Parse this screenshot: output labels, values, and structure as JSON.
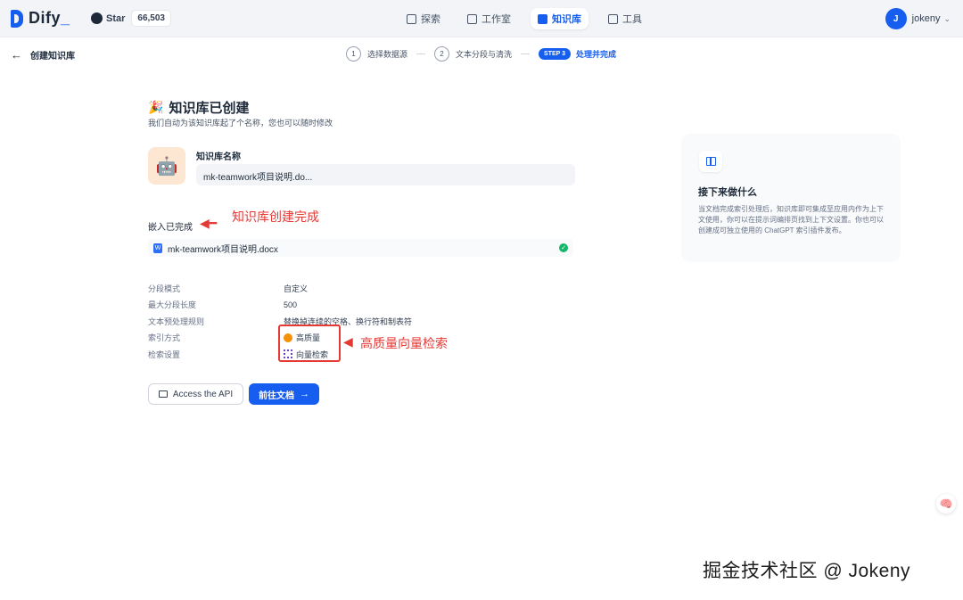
{
  "topbar": {
    "logo": "Dify",
    "github_label": "Star",
    "github_count": "66,503",
    "nav": [
      {
        "label": "探索",
        "icon": "explore-icon"
      },
      {
        "label": "工作室",
        "icon": "studio-icon"
      },
      {
        "label": "知识库",
        "icon": "knowledge-icon"
      },
      {
        "label": "工具",
        "icon": "tools-icon"
      }
    ],
    "active_nav": "知识库",
    "user": {
      "initial": "J",
      "name": "jokeny"
    }
  },
  "subheader": {
    "back_label": "创建知识库",
    "steps": [
      {
        "num": "1",
        "label": "选择数据源"
      },
      {
        "num": "2",
        "label": "文本分段与清洗"
      },
      {
        "num": "STEP 3",
        "label": "处理并完成"
      }
    ]
  },
  "main": {
    "title": "知识库已创建",
    "subtitle": "我们自动为该知识库起了个名称，您也可以随时修改",
    "name_label": "知识库名称",
    "name_value": "mk-teamwork项目说明.do...",
    "embed_label": "嵌入已完成",
    "file_name": "mk-teamwork项目说明.docx",
    "info": [
      {
        "key": "分段模式",
        "value": "自定义"
      },
      {
        "key": "最大分段长度",
        "value": "500"
      },
      {
        "key": "文本预处理规则",
        "value": "替换掉连续的空格、换行符和制表符"
      },
      {
        "key": "索引方式",
        "value": "高质量"
      },
      {
        "key": "检索设置",
        "value": "向量检索"
      }
    ],
    "btn_api": "Access the API",
    "btn_doc": "前往文档"
  },
  "annotations": {
    "embed_note": "知识库创建完成",
    "index_note": "高质量向量检索"
  },
  "panel": {
    "title": "接下来做什么",
    "body": "当文档完成索引处理后，知识库即可集成至应用内作为上下文使用，你可以在提示词编排页找到上下文设置。你也可以创建成可独立使用的 ChatGPT 索引插件发布。"
  },
  "watermark": "掘金技术社区 @ Jokeny",
  "colors": {
    "accent": "#155eef",
    "annotation": "#e53935",
    "success": "#12b76a"
  }
}
